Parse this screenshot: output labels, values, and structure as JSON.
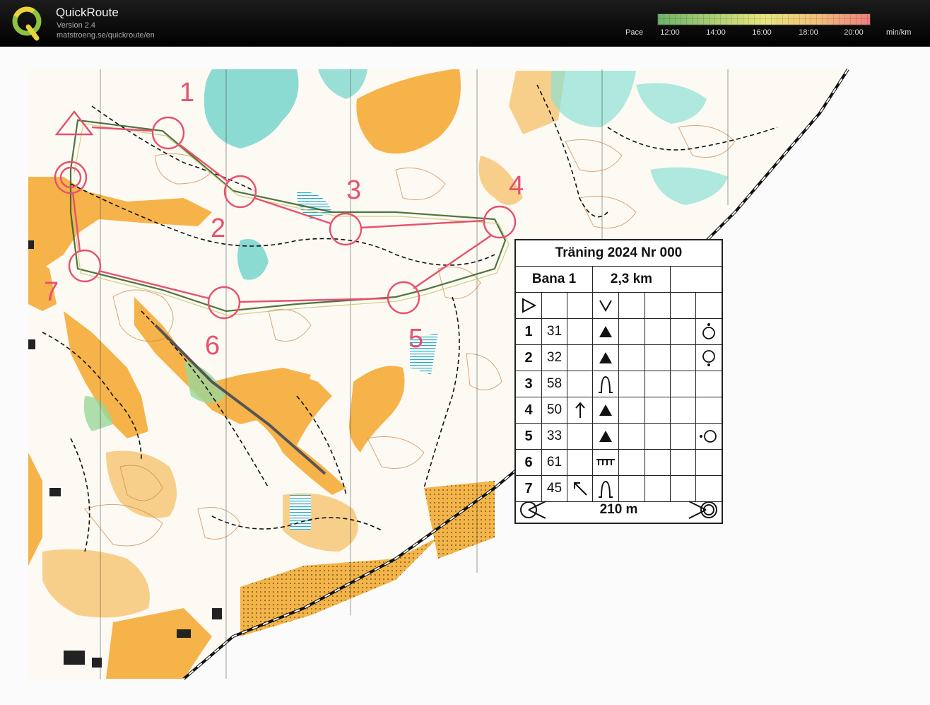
{
  "app": {
    "name": "QuickRoute",
    "version": "Version 2.4",
    "url": "matstroeng.se/quickroute/en",
    "logo_letter": "Q"
  },
  "pace_scale": {
    "label": "Pace",
    "ticks": [
      "12:00",
      "14:00",
      "16:00",
      "18:00",
      "20:00"
    ],
    "unit": "min/km"
  },
  "map": {
    "control_numbers": [
      "1",
      "2",
      "3",
      "4",
      "5",
      "6",
      "7"
    ]
  },
  "control_description": {
    "title": "Träning 2024 Nr 000",
    "course": "Bana 1",
    "length": "2,3 km",
    "controls": [
      {
        "num": "1",
        "code": "31"
      },
      {
        "num": "2",
        "code": "32"
      },
      {
        "num": "3",
        "code": "58"
      },
      {
        "num": "4",
        "code": "50"
      },
      {
        "num": "5",
        "code": "33"
      },
      {
        "num": "6",
        "code": "61"
      },
      {
        "num": "7",
        "code": "45"
      }
    ],
    "finish_distance": "210 m"
  }
}
